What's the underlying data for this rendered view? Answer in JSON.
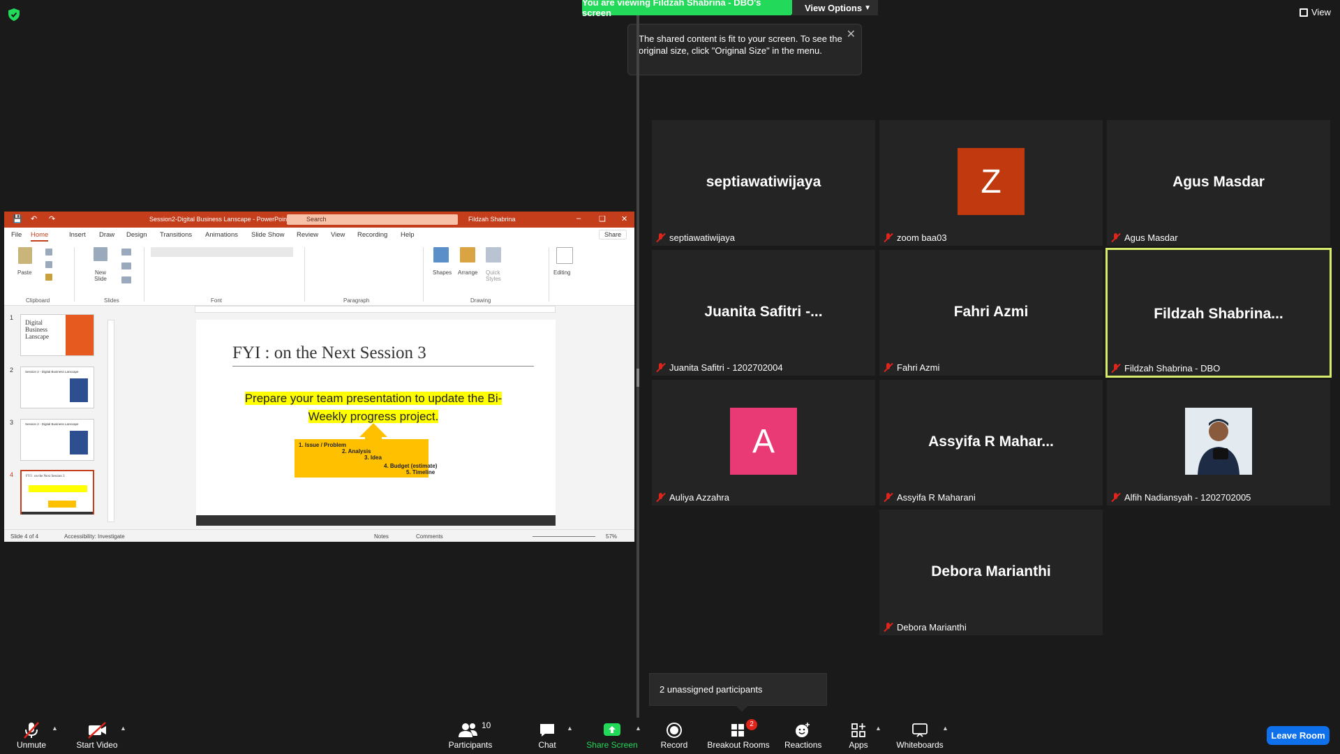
{
  "banner": {
    "text": "You are viewing Fildzah Shabrina - DBO's screen"
  },
  "view_options": {
    "label": "View Options"
  },
  "tooltip": {
    "text": "The shared content is fit to your screen. To see the original size, click \"Original Size\" in the menu."
  },
  "top_right": {
    "view_label": "View"
  },
  "tiles": [
    {
      "display": "septiawatiwijaya",
      "footer": "septiawatiwijaya"
    },
    {
      "display": "Z",
      "footer": "zoom baa03",
      "avatar_color": "#c1390e"
    },
    {
      "display": "Agus Masdar",
      "footer": "Agus Masdar"
    },
    {
      "display": "Juanita Safitri -...",
      "footer": "Juanita Safitri - 1202702004"
    },
    {
      "display": "Fahri Azmi",
      "footer": "Fahri Azmi"
    },
    {
      "display": "Fildzah Shabrina...",
      "footer": "Fildzah Shabrina - DBO",
      "active": true
    },
    {
      "display": "A",
      "footer": "Auliya Azzahra",
      "avatar_color": "#e93a76"
    },
    {
      "display": "Assyifa R Mahar...",
      "footer": "Assyifa R Maharani"
    },
    {
      "display": "",
      "footer": "Alfih Nadiansyah - 1202702005"
    },
    {
      "display": "Debora Marianthi",
      "footer": "Debora Marianthi"
    }
  ],
  "unassigned": {
    "text": "2 unassigned participants"
  },
  "toolbar": {
    "unmute": "Unmute",
    "start_video": "Start Video",
    "participants": "Participants",
    "participants_count": "10",
    "chat": "Chat",
    "share_screen": "Share Screen",
    "record": "Record",
    "breakout_rooms": "Breakout Rooms",
    "breakout_badge": "2",
    "reactions": "Reactions",
    "apps": "Apps",
    "whiteboards": "Whiteboards",
    "leave_room": "Leave Room"
  },
  "ppt": {
    "title": "Session2-Digital Business Lanscape  -  PowerPoint",
    "search_placeholder": "Search",
    "user": "Fildzah Shabrina",
    "menu": [
      "File",
      "Home",
      "Insert",
      "Draw",
      "Design",
      "Transitions",
      "Animations",
      "Slide Show",
      "Review",
      "View",
      "Recording",
      "Help"
    ],
    "share": "Share",
    "ribbon": {
      "paste": "Paste",
      "new_slide": "New Slide",
      "shapes": "Shapes",
      "arrange": "Arrange",
      "quick_styles": "Quick Styles",
      "editing": "Editing",
      "groups": [
        "Clipboard",
        "Slides",
        "Font",
        "Paragraph",
        "Drawing"
      ]
    },
    "thumbnails": [
      {
        "num": "1",
        "text": "Digital Business Lanscape"
      },
      {
        "num": "2",
        "text": "Session 2 - Digital Business Lanscape"
      },
      {
        "num": "3",
        "text": "Session 2 - Digital Business Lanscape"
      },
      {
        "num": "4",
        "text": "FYI : on the Next Session 3"
      }
    ],
    "slide": {
      "title": "FYI : on the Next Session 3",
      "body_line1": "Prepare your team presentation to update the Bi-",
      "body_line2": "Weekly progress project.",
      "list": [
        "1.   Issue / Problem",
        "2. Analysis",
        "3. Idea",
        "4. Budget (estimate)",
        "5. Timeline"
      ]
    },
    "status": {
      "slide_of": "Slide 4 of 4",
      "accessibility": "Accessibility: Investigate",
      "notes": "Notes",
      "comments": "Comments",
      "zoom": "57%"
    }
  }
}
